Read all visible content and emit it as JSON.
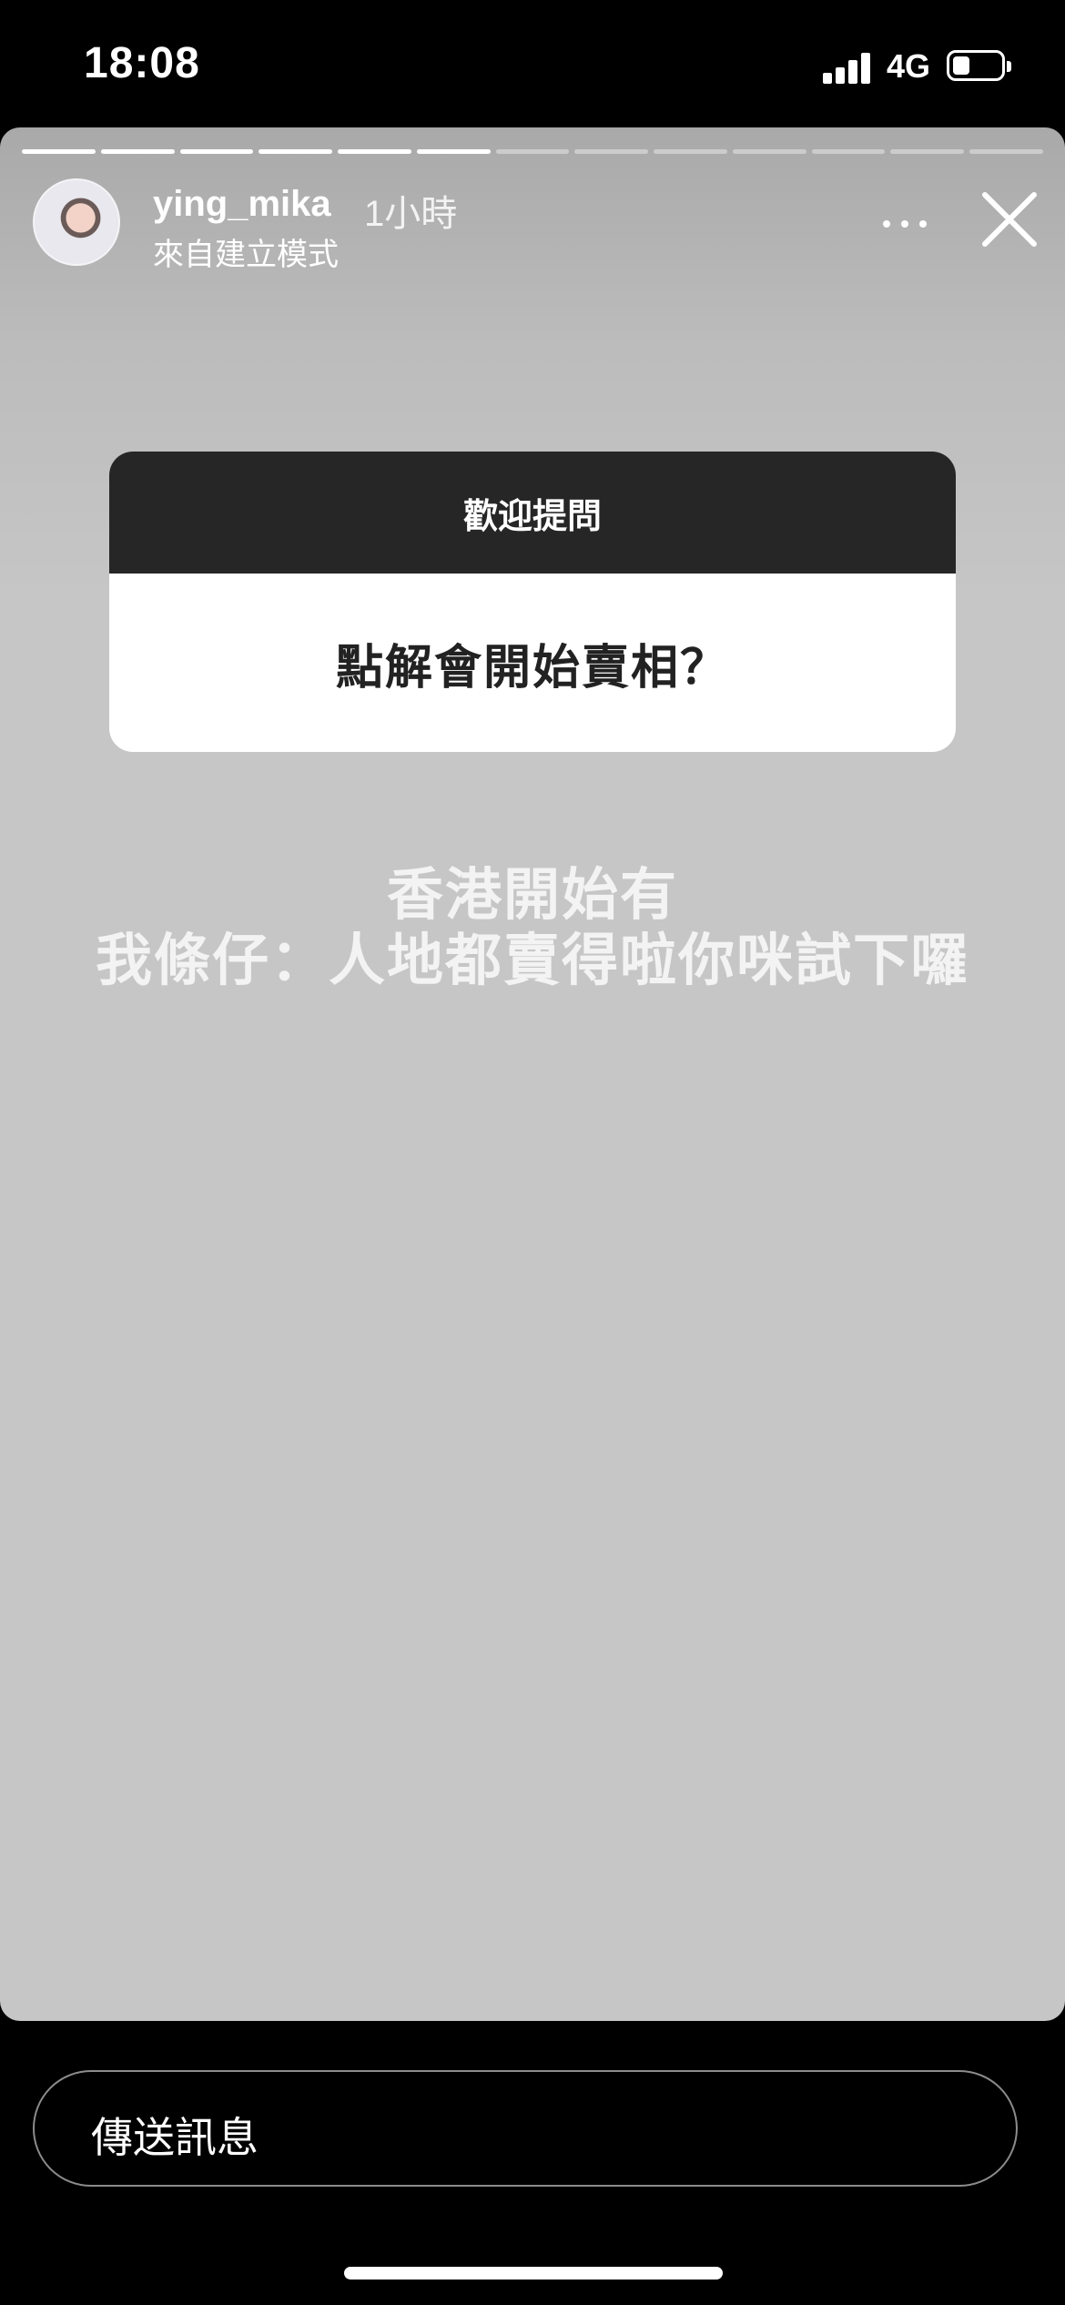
{
  "status_bar": {
    "time": "18:08",
    "network": "4G"
  },
  "story": {
    "progress": {
      "segments": 13,
      "completed": 6,
      "current_fraction": 0.0
    },
    "username": "ying_mika",
    "timestamp": "1小時",
    "subline": "來自建立模式",
    "menu_icon": "more-horizontal-icon",
    "close_icon": "close-icon",
    "question_sticker": {
      "title": "歡迎提問",
      "question": "點解會開始賣相？"
    },
    "answer": [
      "香港開始有",
      "我條仔：人地都賣得啦你咪試下囉"
    ]
  },
  "message_input": {
    "placeholder": "傳送訊息"
  }
}
